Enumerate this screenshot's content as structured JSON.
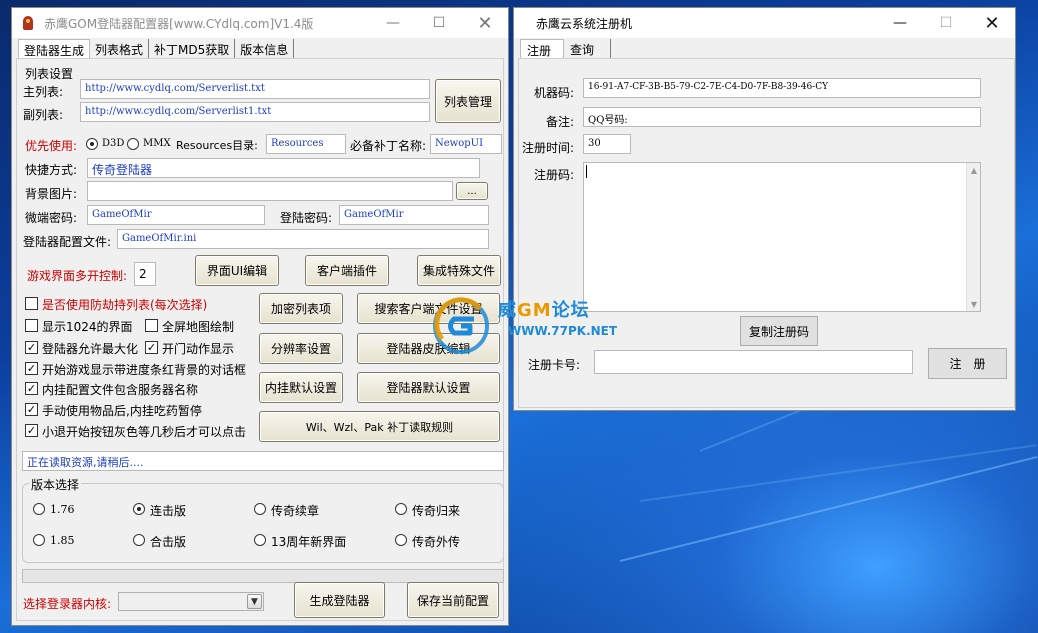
{
  "win1": {
    "title": "赤鹰GOM登陆器配置器[www.CYdlq.com]V1.4版",
    "minimize": "—",
    "maximize": "☐",
    "close": "✕",
    "tabs": [
      "登陆器生成",
      "列表格式",
      "补丁MD5获取",
      "版本信息"
    ],
    "list_settings_label": "列表设置",
    "main_list_label": "主列表:",
    "main_list_value": "http://www.cydlq.com/Serverlist.txt",
    "sub_list_label": "副列表:",
    "sub_list_value": "http://www.cydlq.com/Serverlist1.txt",
    "list_manage_button": "列表管理",
    "priority_label": "优先使用:",
    "d3d_label": "D3D",
    "mmx_label": "MMX",
    "resources_label": "Resources目录:",
    "resources_value": "Resources",
    "patch_label": "必备补丁名称:",
    "patch_value": "NewopUI",
    "shortcut_label": "快捷方式:",
    "shortcut_value": "传奇登陆器",
    "bg_label": "背景图片:",
    "bg_value": "",
    "browse_button": "...",
    "micro_pwd_label": "微端密码:",
    "micro_pwd_value": "GameOfMir",
    "login_pwd_label": "登陆密码:",
    "login_pwd_value": "GameOfMir",
    "config_file_label": "登陆器配置文件:",
    "config_file_value": "GameOfMir.ini",
    "multi_open_label": "游戏界面多开控制:",
    "multi_open_value": "2",
    "btn_ui_edit": "界面UI编辑",
    "btn_client_plugin": "客户端插件",
    "btn_integrate": "集成特殊文件",
    "checkboxes": [
      {
        "label": "是否使用防劫持列表(每次选择)",
        "checked": false,
        "red": true
      },
      {
        "label": "显示1024的界面",
        "checked": false,
        "red": false
      },
      {
        "label": "全屏地图绘制",
        "checked": false,
        "red": false
      },
      {
        "label": "登陆器允许最大化",
        "checked": true,
        "red": false
      },
      {
        "label": "开门动作显示",
        "checked": true,
        "red": false
      },
      {
        "label": "开始游戏显示带进度条红背景的对话框",
        "checked": true,
        "red": false
      },
      {
        "label": "内挂配置文件包含服务器名称",
        "checked": true,
        "red": false
      },
      {
        "label": "手动使用物品后,内挂吃药暂停",
        "checked": true,
        "red": false
      },
      {
        "label": "小退开始按钮灰色等几秒后才可以点击",
        "checked": true,
        "red": false
      }
    ],
    "check_mark": "✓",
    "btn_encrypt_list": "加密列表项",
    "btn_search_client": "搜索客户端文件设置",
    "btn_resolution": "分辨率设置",
    "btn_skin_edit": "登陆器皮肤编辑",
    "btn_plugin_default": "内挂默认设置",
    "btn_login_default": "登陆器默认设置",
    "btn_wil_rules": "Wil、Wzl、Pak 补丁读取规则",
    "status_text": "正在读取资源,请稍后....",
    "version_group_title": "版本选择",
    "versions": [
      {
        "label": "1.76",
        "selected": false
      },
      {
        "label": "连击版",
        "selected": true
      },
      {
        "label": "传奇续章",
        "selected": false
      },
      {
        "label": "传奇归来",
        "selected": false
      },
      {
        "label": "1.85",
        "selected": false
      },
      {
        "label": "合击版",
        "selected": false
      },
      {
        "label": "13周年新界面",
        "selected": false
      },
      {
        "label": "传奇外传",
        "selected": false
      }
    ],
    "kernel_label": "选择登录器内核:",
    "kernel_value": "",
    "combo_arrow": "▼",
    "btn_generate": "生成登陆器",
    "btn_save_config": "保存当前配置"
  },
  "win2": {
    "title": "赤鹰云系统注册机",
    "minimize": "—",
    "maximize": "☐",
    "close": "✕",
    "tabs": [
      "注册",
      "查询"
    ],
    "machine_code_label": "机器码:",
    "machine_code_value": "16-91-A7-CF-3B-B5-79-C2-7E-C4-D0-7F-B8-39-46-CY",
    "remark_label": "备注:",
    "remark_value": "QQ号码:",
    "reg_time_label": "注册时间:",
    "reg_time_value": "30",
    "reg_code_label": "注册码:",
    "copy_button": "复制注册码",
    "card_label": "注册卡号:",
    "card_value": "",
    "register_button": "注　册",
    "scroll_up": "▲",
    "scroll_down": "▼"
  },
  "watermark": {
    "line1_a": "威",
    "line1_b": "GM",
    "line1_c": "论坛",
    "line2": "WWW.77PK.NET"
  },
  "colors": {
    "label_red": "#d10000",
    "field_text_blue": "#1a3cc8",
    "watermark_blue": "#1f8ad8",
    "watermark_orange": "#e89a00"
  }
}
